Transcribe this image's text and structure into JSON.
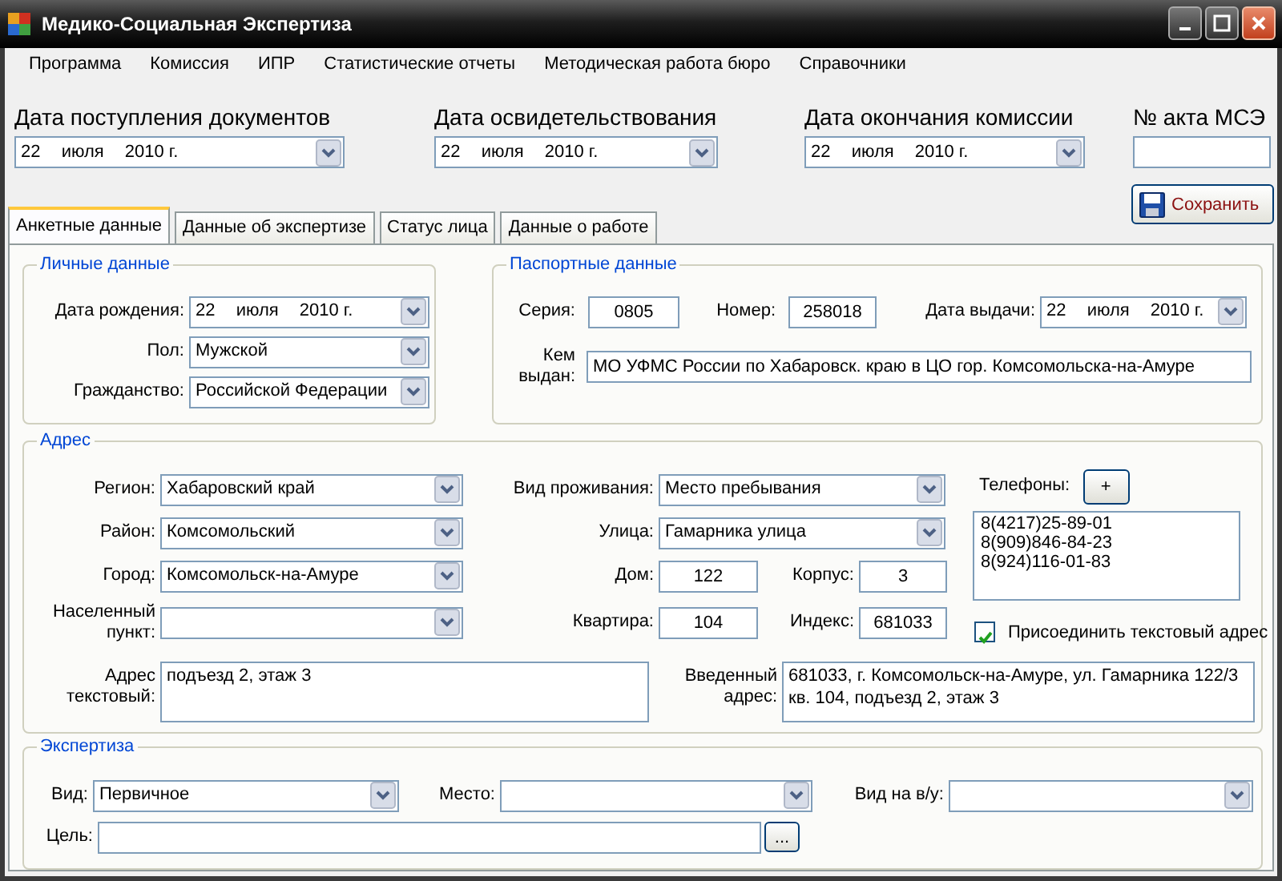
{
  "window": {
    "title": "Медико-Социальная Экспертиза"
  },
  "menu": [
    "Программа",
    "Комиссия",
    "ИПР",
    "Статистические отчеты",
    "Методическая работа бюро",
    "Справочники"
  ],
  "header": [
    {
      "label": "Дата поступления документов",
      "kind": "date",
      "day": "22",
      "month": "июля",
      "year": "2010 г."
    },
    {
      "label": "Дата освидетельствования",
      "kind": "date",
      "day": "22",
      "month": "июля",
      "year": "2010 г."
    },
    {
      "label": "Дата окончания комиссии",
      "kind": "date",
      "day": "22",
      "month": "июля",
      "year": "2010 г."
    },
    {
      "label": "№ акта МСЭ",
      "kind": "text"
    }
  ],
  "tabs": [
    {
      "label": "Анкетные данные",
      "selected": true
    },
    {
      "label": "Данные об экспертизе",
      "selected": false
    },
    {
      "label": "Статус лица",
      "selected": false
    },
    {
      "label": "Данные о работе",
      "selected": false
    }
  ],
  "save_button": "Сохранить",
  "personal": {
    "title": "Личные данные",
    "fields": [
      {
        "label": "Дата рождения:",
        "kind": "date",
        "day": "22",
        "month": "июля",
        "year": "2010 г."
      },
      {
        "label": "Пол:",
        "kind": "combo",
        "value": "Мужской"
      },
      {
        "label": "Гражданство:",
        "kind": "combo",
        "value": "Российской Федерации"
      }
    ]
  },
  "passport": {
    "title": "Паспортные данные",
    "series": {
      "label": "Серия:",
      "value": "0805"
    },
    "number": {
      "label": "Номер:",
      "value": "258018"
    },
    "issue_date": {
      "label": "Дата выдачи:",
      "day": "22",
      "month": "июля",
      "year": "2010 г."
    },
    "issued_by": {
      "label": "Кем выдан:",
      "value": "МО УФМС России по Хабаровск. краю в ЦО гор. Комсомольска-на-Амуре"
    }
  },
  "address": {
    "title": "Адрес",
    "left": [
      {
        "label": "Регион:",
        "kind": "combo",
        "value": "Хабаровский край"
      },
      {
        "label": "Район:",
        "kind": "combo",
        "value": "Комсомольский"
      },
      {
        "label": "Город:",
        "kind": "combo",
        "value": "Комсомольск-на-Амуре"
      },
      {
        "label": "Населенный пункт:",
        "kind": "combo"
      }
    ],
    "middle": [
      {
        "label": "Вид проживания:",
        "kind": "combo",
        "value": "Место пребывания"
      },
      {
        "label": "Улица:",
        "kind": "combo",
        "value": "Гамарника улица"
      },
      {
        "kind": "pair",
        "items": [
          {
            "label": "Дом:",
            "value": "122"
          },
          {
            "label": "Корпус:",
            "value": "3"
          }
        ]
      },
      {
        "kind": "pair",
        "items": [
          {
            "label": "Квартира:",
            "value": "104"
          },
          {
            "label": "Индекс:",
            "value": "681033"
          }
        ]
      }
    ],
    "phones": {
      "label": "Телефоны:",
      "add_button": "+",
      "items": [
        "8(4217)25-89-01",
        "8(909)846-84-23",
        "8(924)116-01-83"
      ]
    },
    "attach": {
      "label": "Присоединить текстовый адрес",
      "checked": true
    },
    "text_address": {
      "label": "Адрес текстовый:",
      "lines": [
        "подъезд 2, этаж 3"
      ]
    },
    "entered_address": {
      "label": "Введенный адрес:",
      "lines": [
        "681033, г. Комсомольск-на-Амуре, ул. Гамарника 122/3",
        "кв. 104, подъезд 2, этаж 3"
      ]
    }
  },
  "expertise": {
    "title": "Экспертиза",
    "fields": [
      {
        "label": "Вид:",
        "kind": "combo",
        "value": "Первичное"
      },
      {
        "label": "Место:",
        "kind": "combo"
      },
      {
        "label": "Вид на в/у:",
        "kind": "combo"
      }
    ],
    "goal": {
      "label": "Цель:",
      "button": "..."
    }
  }
}
